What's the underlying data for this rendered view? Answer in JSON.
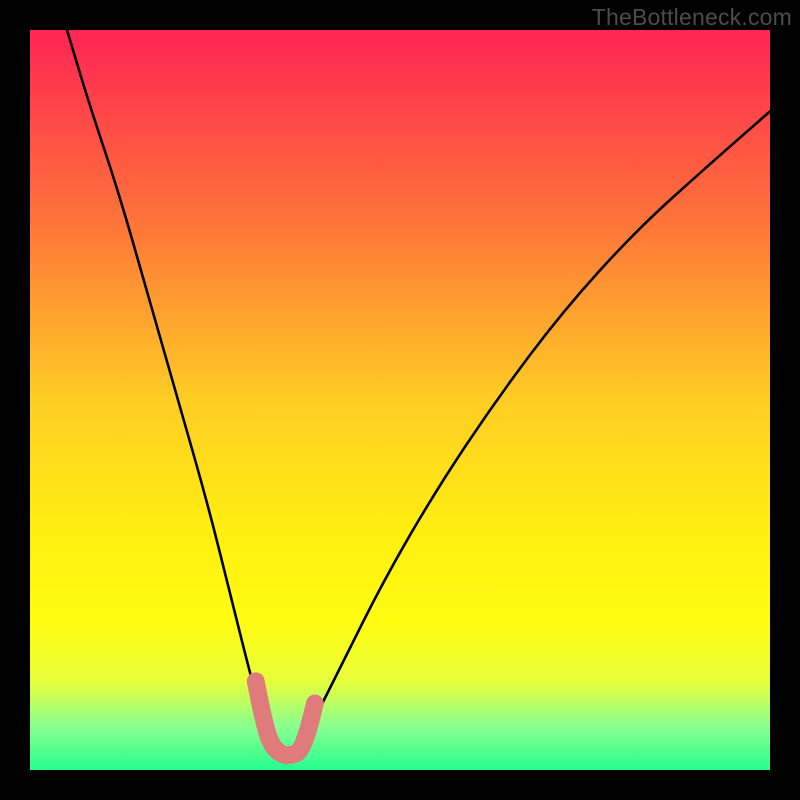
{
  "watermark": {
    "text": "TheBottleneck.com"
  },
  "chart_data": {
    "type": "line",
    "title": "",
    "xlabel": "",
    "ylabel": "",
    "xlim": [
      0,
      100
    ],
    "ylim": [
      0,
      100
    ],
    "grid": false,
    "legend": false,
    "background_gradient": {
      "direction": "vertical",
      "stops": [
        {
          "pos": 0.0,
          "color": "#ff2454"
        },
        {
          "pos": 0.25,
          "color": "#ff713a"
        },
        {
          "pos": 0.5,
          "color": "#ffcd24"
        },
        {
          "pos": 0.68,
          "color": "#ffef10"
        },
        {
          "pos": 0.8,
          "color": "#fffc11"
        },
        {
          "pos": 0.88,
          "color": "#e6ff3b"
        },
        {
          "pos": 0.94,
          "color": "#8cff8e"
        },
        {
          "pos": 1.0,
          "color": "#26ff8f"
        }
      ]
    },
    "series": [
      {
        "name": "bottleneck-curve",
        "color": "#000000",
        "description": "V-shaped curve, minimum near x≈34, going to ~100% at edges (right side shallower)",
        "x": [
          5,
          8,
          12,
          16,
          20,
          24,
          27,
          30,
          32,
          34,
          36,
          38,
          42,
          48,
          55,
          63,
          72,
          82,
          92,
          100
        ],
        "y": [
          100,
          90,
          78,
          64,
          50,
          36,
          24,
          12,
          5,
          2,
          3,
          6,
          14,
          26,
          38,
          50,
          62,
          73,
          82,
          89
        ]
      },
      {
        "name": "bottleneck-marker-band",
        "color": "#df7b7a",
        "description": "Thick salmon overlay near the minimum of the curve",
        "x": [
          30.5,
          31.5,
          32.5,
          34,
          35.5,
          36.5,
          37.5,
          38.5
        ],
        "y": [
          12,
          7,
          3.5,
          2,
          2,
          2.5,
          5,
          9
        ]
      }
    ]
  }
}
